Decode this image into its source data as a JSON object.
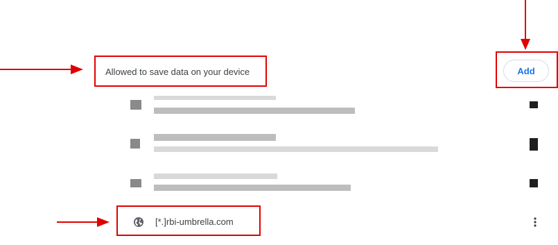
{
  "section": {
    "heading": "Allowed to save data on your device",
    "add_label": "Add"
  },
  "site": {
    "label": "[*.]rbi-umbrella.com",
    "icon": "globe-icon",
    "more_icon": "more-vert-icon"
  },
  "colors": {
    "annotation": "#e00000",
    "accent": "#1a73e8",
    "text": "#3c4043"
  }
}
